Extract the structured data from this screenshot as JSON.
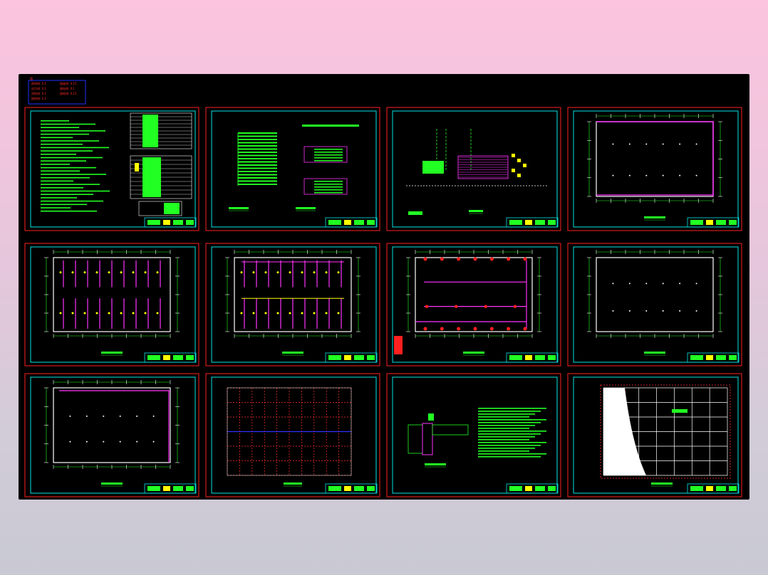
{
  "legend": {
    "marker": "图",
    "rows": [
      [
        "照明线: 0.1",
        "插座线: 0.15"
      ],
      [
        "动力线: 0.1",
        "弱电线: 0.1"
      ],
      [
        "消防线: 0.1",
        "接地线: 0.15"
      ],
      [
        "接地线: 0.1",
        ""
      ]
    ]
  },
  "sheets": [
    {
      "id": "design-notes",
      "kind": "notes"
    },
    {
      "id": "system-diagram-1",
      "kind": "system"
    },
    {
      "id": "system-diagram-2",
      "kind": "riser"
    },
    {
      "id": "plan-perimeter",
      "kind": "plan"
    },
    {
      "id": "plan-lighting-a",
      "kind": "plan"
    },
    {
      "id": "plan-lighting-b",
      "kind": "plan"
    },
    {
      "id": "plan-power",
      "kind": "plan"
    },
    {
      "id": "plan-empty-a",
      "kind": "plan"
    },
    {
      "id": "plan-empty-b",
      "kind": "plan"
    },
    {
      "id": "plan-grid",
      "kind": "grid"
    },
    {
      "id": "detail-grounding",
      "kind": "detail"
    },
    {
      "id": "plan-roof",
      "kind": "roof"
    }
  ],
  "colors": {
    "sheet_border": "#ff2020",
    "inner_frame": "#00e5e5",
    "text": "#22ff22",
    "wire": "#ff33ff",
    "wall": "#ffffff",
    "axis": "#ff3030",
    "blue": "#3030ff",
    "yellow": "#ffff00"
  }
}
